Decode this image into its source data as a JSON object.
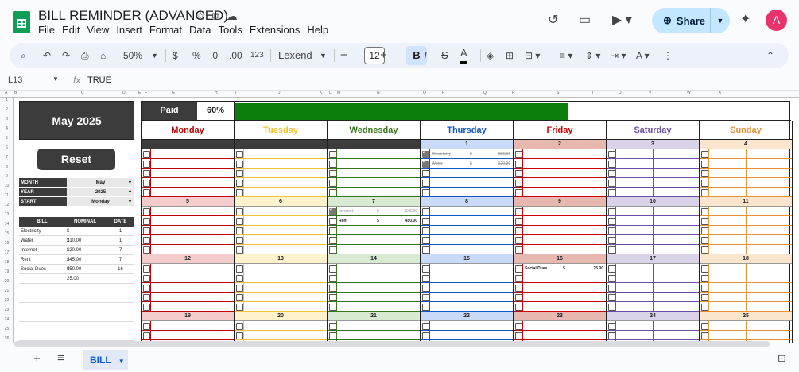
{
  "app": {
    "title": "BILL REMINDER (ADVANCED)",
    "menus": [
      "File",
      "Edit",
      "View",
      "Insert",
      "Format",
      "Data",
      "Tools",
      "Extensions",
      "Help"
    ],
    "share_label": "Share",
    "avatar_letter": "A"
  },
  "toolbar": {
    "zoom": "50%",
    "currency": "$",
    "percent": "%",
    "dec_less": ".0",
    "dec_more": ".00",
    "number_format": "123",
    "font": "Lexend",
    "font_size": "12",
    "bold": "B",
    "italic": "I",
    "strike": "S",
    "text_color": "A"
  },
  "formula_bar": {
    "cell_ref": "L13",
    "fx": "fx",
    "value": "TRUE"
  },
  "columns": [
    "A",
    "B",
    "C",
    "D",
    "E",
    "F",
    "G",
    "H",
    "I",
    "J",
    "K",
    "L",
    "M",
    "N",
    "O",
    "P",
    "Q",
    "R",
    "S",
    "T",
    "U",
    "V",
    "W",
    "X"
  ],
  "rows": [
    "1",
    "2",
    "3",
    "4",
    "5",
    "6",
    "7",
    "8",
    "9",
    "10",
    "11",
    "12",
    "13",
    "14",
    "15",
    "16",
    "17",
    "18",
    "19",
    "20",
    "21",
    "22",
    "23",
    "24",
    "25",
    "26"
  ],
  "sheet": {
    "month_title": "May 2025",
    "reset_label": "Reset",
    "settings": [
      {
        "key": "MONTH",
        "value": "May"
      },
      {
        "key": "YEAR",
        "value": "2025"
      },
      {
        "key": "START",
        "value": "Monday"
      }
    ],
    "bill_headers": {
      "bill": "BILL",
      "nominal": "NOMINAL",
      "date": "DATE"
    },
    "bills": [
      {
        "name": "Electricity",
        "cur": "$",
        "amount": "210.00",
        "date": "1"
      },
      {
        "name": "Water",
        "cur": "$",
        "amount": "120.00",
        "date": "1"
      },
      {
        "name": "Internet",
        "cur": "$",
        "amount": "245.00",
        "date": "7"
      },
      {
        "name": "Rent",
        "cur": "$",
        "amount": "450.00",
        "date": "7"
      },
      {
        "name": "Social Dues",
        "cur": "$",
        "amount": "25.00",
        "date": "16"
      }
    ],
    "paid_label": "Paid",
    "paid_pct": "60%",
    "paid_fraction": 0.6,
    "days": [
      {
        "label": "Monday",
        "color": "#c00000",
        "bg": "#f4cccc",
        "line": "#c00000"
      },
      {
        "label": "Tuesday",
        "color": "#f1c232",
        "bg": "#fff2cc",
        "line": "#f1c232"
      },
      {
        "label": "Wednesday",
        "color": "#38761d",
        "bg": "#d9ead3",
        "line": "#38761d"
      },
      {
        "label": "Thursday",
        "color": "#1155cc",
        "bg": "#c9daf8",
        "line": "#1155cc"
      },
      {
        "label": "Friday",
        "color": "#cc0000",
        "bg": "#e6b8af",
        "line": "#cc0000"
      },
      {
        "label": "Saturday",
        "color": "#674ea7",
        "bg": "#d9d2e9",
        "line": "#674ea7"
      },
      {
        "label": "Sunday",
        "color": "#e69138",
        "bg": "#fce5cd",
        "line": "#e69138"
      }
    ],
    "weeks": [
      [
        "",
        "",
        "",
        "1",
        "2",
        "3",
        "4"
      ],
      [
        "5",
        "6",
        "7",
        "8",
        "9",
        "10",
        "11"
      ],
      [
        "12",
        "13",
        "14",
        "15",
        "16",
        "17",
        "18"
      ],
      [
        "19",
        "20",
        "21",
        "22",
        "23",
        "24",
        "25"
      ]
    ],
    "entries": [
      {
        "week": 0,
        "day": 3,
        "slot": 0,
        "name": "Electricity",
        "cur": "$",
        "amount": "210.00",
        "checked": true
      },
      {
        "week": 0,
        "day": 3,
        "slot": 1,
        "name": "Water",
        "cur": "$",
        "amount": "120.00",
        "checked": true
      },
      {
        "week": 1,
        "day": 2,
        "slot": 0,
        "name": "Internet",
        "cur": "$",
        "amount": "245.00",
        "checked": true
      },
      {
        "week": 1,
        "day": 2,
        "slot": 1,
        "name": "Rent",
        "cur": "$",
        "amount": "450.00",
        "checked": false
      },
      {
        "week": 2,
        "day": 4,
        "slot": 0,
        "name": "Social Dues",
        "cur": "$",
        "amount": "25.00",
        "checked": false
      }
    ]
  },
  "sheet_tab": "BILL"
}
